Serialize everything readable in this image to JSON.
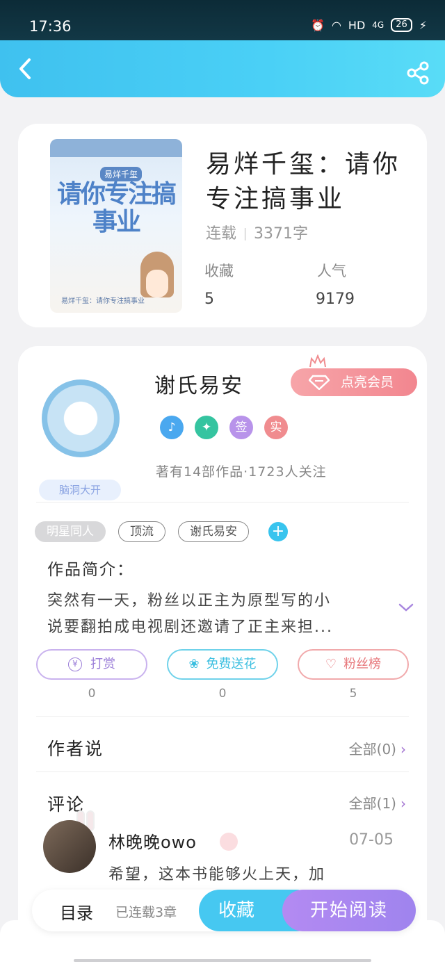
{
  "status_bar": {
    "time": "17:36",
    "network": "HD",
    "signal": "4G",
    "battery": "26"
  },
  "book": {
    "title": "易烊千玺：请你专注搞事业",
    "status": "连载",
    "word_count": "3371字",
    "favorites_label": "收藏",
    "favorites_value": "5",
    "popularity_label": "人气",
    "popularity_value": "9179",
    "cover": {
      "small_label": "易烊千玺",
      "title": "请你专注搞事业",
      "subtitle": "易烊千玺：请你专注搞事业"
    }
  },
  "author": {
    "name": "谢氏易安",
    "badge": "脑洞大开",
    "vip_button": "点亮会员",
    "medals": [
      {
        "label": "",
        "color": "#4aa8ef"
      },
      {
        "label": "",
        "color": "#35c4a0"
      },
      {
        "label": "签",
        "color": "#b893ea"
      },
      {
        "label": "实",
        "color": "#f08c8f"
      }
    ],
    "works_text": "著有14部作品·1723人关注"
  },
  "tags": [
    "明星同人",
    "顶流",
    "谢氏易安"
  ],
  "intro": {
    "title": "作品简介：",
    "text_line1": "突然有一天，粉丝以正主为原型写的小",
    "text_line2": "说要翻拍成电视剧还邀请了正主来担..."
  },
  "actions": [
    {
      "label": "打赏",
      "count": "0",
      "color": "#b99ae6"
    },
    {
      "label": "免费送花",
      "count": "0",
      "color": "#4ccbe8"
    },
    {
      "label": "粉丝榜",
      "count": "5",
      "color": "#ef9a9c"
    }
  ],
  "author_says": {
    "title": "作者说",
    "more": "全部(0)"
  },
  "comments": {
    "title": "评论",
    "more": "全部(1)",
    "item": {
      "user": "林晚晚owo",
      "date": "07-05",
      "text": "希望，这本书能够火上天，加"
    }
  },
  "bottom_bar": {
    "catalog": "目录",
    "status": "已连载3章",
    "favorite": "收藏",
    "read": "开始阅读"
  }
}
